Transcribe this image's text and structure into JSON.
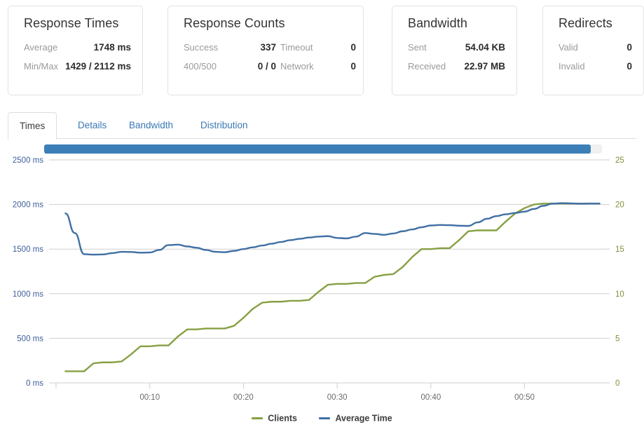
{
  "cards": [
    {
      "title": "Response Times",
      "layout": "single",
      "rows": [
        {
          "label": "Average",
          "value": "1748 ms"
        },
        {
          "label": "Min/Max",
          "value": "1429 / 2112 ms"
        }
      ]
    },
    {
      "title": "Response Counts",
      "layout": "double",
      "rows": [
        {
          "label": "Success",
          "value": "337",
          "label2": "Timeout",
          "value2": "0"
        },
        {
          "label": "400/500",
          "value": "0 / 0",
          "label2": "Network",
          "value2": "0"
        }
      ]
    },
    {
      "title": "Bandwidth",
      "layout": "single",
      "rows": [
        {
          "label": "Sent",
          "value": "54.04 KB"
        },
        {
          "label": "Received",
          "value": "22.97 MB"
        }
      ]
    },
    {
      "title": "Redirects",
      "layout": "single",
      "rows": [
        {
          "label": "Valid",
          "value": "0"
        },
        {
          "label": "Invalid",
          "value": "0"
        }
      ]
    }
  ],
  "tabs": [
    {
      "label": "Times",
      "active": true
    },
    {
      "label": "Details",
      "active": false
    },
    {
      "label": "Bandwidth",
      "active": false
    },
    {
      "label": "Distribution",
      "active": false
    }
  ],
  "range_selector": {
    "fill_percent": 98
  },
  "colors": {
    "clients": "#86a043",
    "average_time": "#3f6fa3",
    "left_axis": "#3f5e9b",
    "right_axis": "#7e8f3a",
    "tab_link": "#3a78b5",
    "scrollbar": "#3c7fb8"
  },
  "chart_data": {
    "type": "line",
    "title": "",
    "xlabel": "",
    "ylabel": "",
    "grid": true,
    "legend_position": "bottom",
    "x_ticks": [
      "00:10",
      "00:20",
      "00:30",
      "00:40",
      "00:50"
    ],
    "x_tick_seconds": [
      600,
      1200,
      1800,
      2400,
      3000
    ],
    "xlim_seconds": [
      0,
      3500
    ],
    "left_axis": {
      "label": "ms",
      "ticks": [
        "0 ms",
        "500 ms",
        "1000 ms",
        "1500 ms",
        "2000 ms",
        "2500 ms"
      ],
      "tick_values": [
        0,
        500,
        1000,
        1500,
        2000,
        2500
      ],
      "ylim": [
        0,
        2500
      ]
    },
    "right_axis": {
      "label": "clients",
      "ticks": [
        "0",
        "5",
        "10",
        "15",
        "20",
        "25"
      ],
      "tick_values": [
        0,
        5,
        10,
        15,
        20,
        25
      ],
      "ylim": [
        0,
        25
      ]
    },
    "series": [
      {
        "name": "Clients",
        "axis": "right",
        "color": "#86a043",
        "x": [
          60,
          120,
          180,
          240,
          300,
          360,
          420,
          480,
          540,
          600,
          660,
          720,
          780,
          840,
          900,
          960,
          1020,
          1080,
          1140,
          1200,
          1260,
          1320,
          1380,
          1440,
          1500,
          1560,
          1620,
          1680,
          1740,
          1800,
          1860,
          1920,
          1980,
          2040,
          2100,
          2160,
          2220,
          2280,
          2340,
          2400,
          2460,
          2520,
          2580,
          2640,
          2700,
          2760,
          2820,
          2880,
          2940,
          3000,
          3060,
          3120,
          3180,
          3240,
          3300,
          3360,
          3420,
          3480
        ],
        "values": [
          1.3,
          1.3,
          1.3,
          2.2,
          2.3,
          2.3,
          2.4,
          3.2,
          4.1,
          4.1,
          4.2,
          4.2,
          5.2,
          6.0,
          6.0,
          6.1,
          6.1,
          6.1,
          6.4,
          7.3,
          8.3,
          9.0,
          9.1,
          9.1,
          9.2,
          9.2,
          9.3,
          10.2,
          11.0,
          11.1,
          11.1,
          11.2,
          11.2,
          11.9,
          12.1,
          12.2,
          13.0,
          14.1,
          15.0,
          15.0,
          15.1,
          15.1,
          16.0,
          17.0,
          17.1,
          17.1,
          17.1,
          18.1,
          19.0,
          19.6,
          20.0,
          20.1,
          20.1,
          20.1,
          20.1,
          20.1,
          20.1,
          20.1
        ]
      },
      {
        "name": "Average Time",
        "axis": "left",
        "color": "#3f6fa3",
        "x": [
          60,
          120,
          180,
          240,
          300,
          360,
          420,
          480,
          540,
          600,
          660,
          720,
          780,
          840,
          900,
          960,
          1020,
          1080,
          1140,
          1200,
          1260,
          1320,
          1380,
          1440,
          1500,
          1560,
          1620,
          1680,
          1740,
          1800,
          1860,
          1920,
          1980,
          2040,
          2100,
          2160,
          2220,
          2280,
          2340,
          2400,
          2460,
          2520,
          2580,
          2640,
          2700,
          2760,
          2820,
          2880,
          2940,
          3000,
          3060,
          3120,
          3180,
          3240,
          3300,
          3360,
          3420,
          3480
        ],
        "values": [
          1900,
          1680,
          1443,
          1438,
          1440,
          1455,
          1470,
          1468,
          1460,
          1462,
          1490,
          1545,
          1550,
          1530,
          1515,
          1490,
          1470,
          1465,
          1480,
          1500,
          1520,
          1540,
          1560,
          1580,
          1600,
          1615,
          1630,
          1640,
          1645,
          1625,
          1620,
          1640,
          1680,
          1670,
          1660,
          1675,
          1700,
          1720,
          1745,
          1765,
          1770,
          1768,
          1762,
          1760,
          1800,
          1840,
          1870,
          1890,
          1905,
          1920,
          1950,
          1985,
          2010,
          2015,
          2012,
          2008,
          2010,
          2010
        ]
      }
    ],
    "legend": [
      "Clients",
      "Average Time"
    ]
  }
}
